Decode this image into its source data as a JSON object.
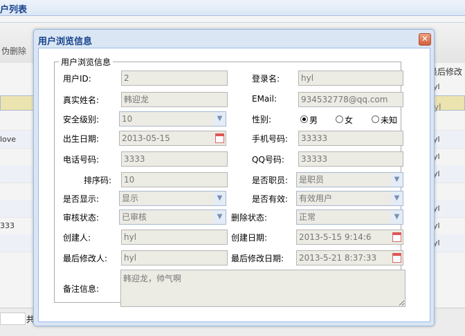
{
  "page": {
    "title": "户列表",
    "delete_button": "伪删除",
    "col_last_modified": "最后修改",
    "pager_text": "共"
  },
  "list_left": [
    "",
    "",
    "",
    "love",
    "",
    "",
    "",
    "",
    "333",
    ""
  ],
  "list_right": [
    "yl",
    "yl",
    "",
    "yl",
    "yl",
    "yl",
    "",
    "yl",
    "yl",
    "yl"
  ],
  "dialog": {
    "title": "用户浏览信息",
    "legend": "用户浏览信息",
    "labels": {
      "user_id": "用户ID:",
      "login": "登录名:",
      "real_name": "真实姓名:",
      "email": "EMail:",
      "security": "安全级别:",
      "gender": "性别:",
      "birth": "出生日期:",
      "mobile": "手机号码:",
      "phone": "电话号码:",
      "qq": "QQ号码:",
      "sort": "排序码:",
      "is_staff": "是否职员:",
      "is_show": "是否显示:",
      "is_valid": "是否有效:",
      "audit": "审核状态:",
      "del_state": "删除状态:",
      "creator": "创建人:",
      "created": "创建日期:",
      "modifier": "最后修改人:",
      "modified": "最后修改日期:",
      "remark": "备注信息:"
    },
    "values": {
      "user_id": "2",
      "login": "hyl",
      "real_name": "韩迎龙",
      "email": "934532778@qq.com",
      "security": "10",
      "birth": "2013-05-15",
      "mobile": "33333",
      "phone": "3333",
      "qq": "33333",
      "sort": "10",
      "is_staff": "是职员",
      "is_show": "显示",
      "is_valid": "有效用户",
      "audit": "已审核",
      "del_state": "正常",
      "creator": "hyl",
      "created": "2013-5-15 9:14:6",
      "modifier": "hyl",
      "modified": "2013-5-21 8:37:33",
      "remark": "韩迎龙，帅气啊"
    },
    "gender_options": [
      "男",
      "女",
      "未知"
    ],
    "gender_selected": "男"
  }
}
